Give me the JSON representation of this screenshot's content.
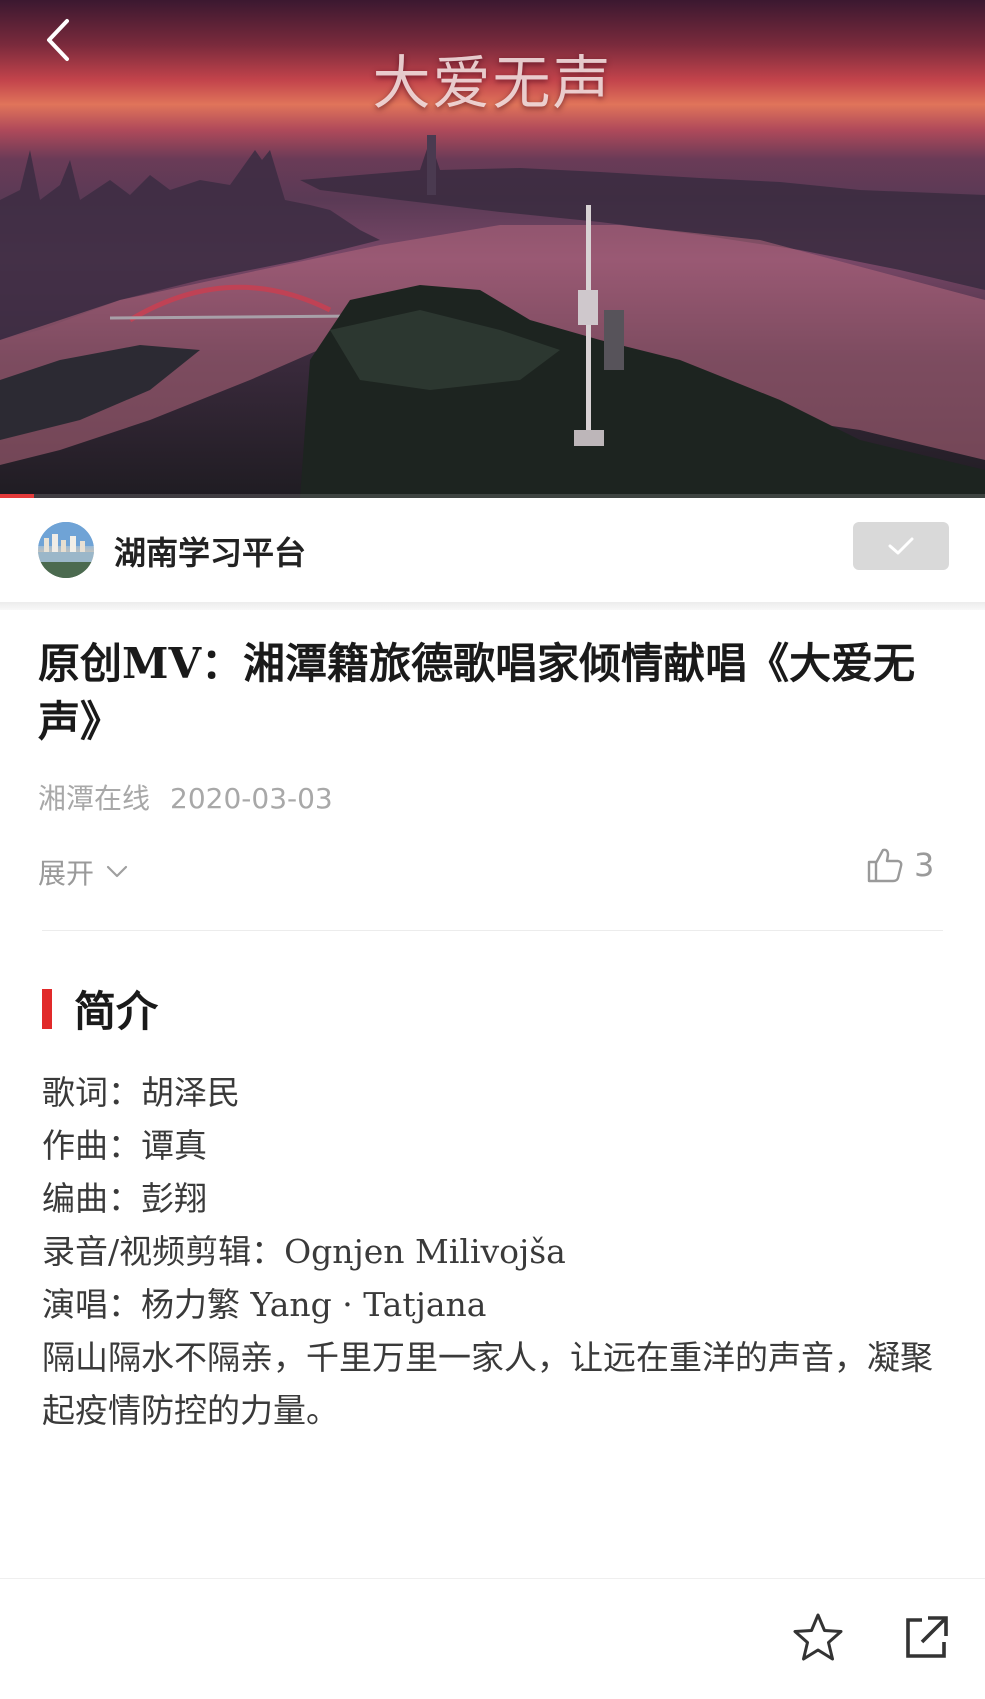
{
  "video": {
    "overlay_title": "大爱无声",
    "back_icon": "chevron-left-icon",
    "progress": 0.035,
    "progress_color": "#e33a3a"
  },
  "publisher": {
    "name": "湖南学习平台",
    "follow_icon": "check-icon"
  },
  "article": {
    "title": "原创MV：湘潭籍旅德歌唱家倾情献唱《大爱无声》",
    "source": "湘潭在线",
    "date": "2020-03-03",
    "expand_label": "展开",
    "like_count": "3"
  },
  "intro": {
    "section_title": "简介",
    "accent_color": "#e12a2a",
    "lines": [
      "歌词：胡泽民",
      "作曲：谭真",
      "编曲：彭翔",
      "录音/视频剪辑：Ognjen Milivojša",
      "演唱：杨力繁 Yang · Tatjana",
      "隔山隔水不隔亲，千里万里一家人，让远在重洋的声音，凝聚起疫情防控的力量。"
    ]
  },
  "toolbar": {
    "favorite_icon": "star-icon",
    "share_icon": "share-icon"
  }
}
